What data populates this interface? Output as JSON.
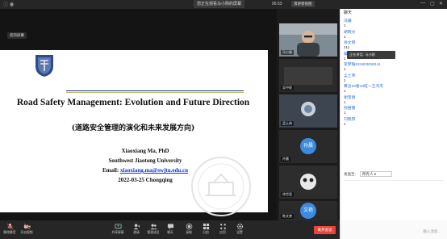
{
  "window": {
    "title": "您正在观看马小刚的屏幕"
  },
  "topbar": {
    "time": "06:53",
    "view_label": "演讲者视图"
  },
  "share": {
    "label": "您的屏幕",
    "slide": {
      "title_en": "Road Safety Management: Evolution and Future Direction",
      "title_cn": "(道路安全管理的演化和未来发展方向)",
      "author": "Xiaoxiang Ma, PhD",
      "university": "Southwest Jiaotong University",
      "email_label": "Email:",
      "email": "xiaoxiang.ma@swjtu.edu.cn",
      "date": "2022-03-25  Chongqing"
    }
  },
  "participants": [
    {
      "name": "马小刚",
      "type": "video",
      "avatar_text": ""
    },
    {
      "name": "吴中权",
      "type": "video",
      "avatar_text": ""
    },
    {
      "name": "孟土伟",
      "type": "video",
      "avatar_text": ""
    },
    {
      "name": "孙晨",
      "type": "avatar",
      "avatar_text": "孙晨"
    },
    {
      "name": "徐世君",
      "type": "video",
      "avatar_text": ""
    },
    {
      "name": "陈文艳",
      "type": "avatar",
      "avatar_text": "文艳"
    }
  ],
  "chat": {
    "title": "聊天",
    "speaking": "正在讲话: 马小刚",
    "messages": [
      {
        "name": "冯巍",
        "text": "1"
      },
      {
        "name": "胡晓文",
        "text": "1"
      },
      {
        "name": "徐文艳",
        "text": "111"
      },
      {
        "name": "蔡宏尧",
        "text": "1"
      },
      {
        "name": "李梦瑜631803090111",
        "text": "1"
      },
      {
        "name": "孟土伟",
        "text": "1"
      },
      {
        "name": "黄治20春19班一王鸿杰",
        "text": "1"
      },
      {
        "name": "谢宝丽",
        "text": "1"
      },
      {
        "name": "倪君健",
        "text": "1"
      },
      {
        "name": "刘晓燕",
        "text": "1"
      }
    ],
    "send_to_label": "发送至:",
    "send_to_value": "所有人",
    "input_placeholder": "输入消息..."
  },
  "toolbar": {
    "items": [
      {
        "label": "解除静音",
        "icon": "microphone-muted-icon"
      },
      {
        "label": "开启视频",
        "icon": "video-off-icon"
      },
      {
        "label": "共享屏幕",
        "icon": "share-screen-icon"
      },
      {
        "label": "邀请",
        "icon": "invite-icon"
      },
      {
        "label": "管理成员",
        "icon": "members-icon"
      },
      {
        "label": "聊天",
        "icon": "chat-icon"
      },
      {
        "label": "录制",
        "icon": "record-icon"
      },
      {
        "label": "分组",
        "icon": "breakout-icon"
      },
      {
        "label": "应用",
        "icon": "apps-icon"
      },
      {
        "label": "设置",
        "icon": "settings-icon"
      }
    ],
    "leave_label": "离开会议"
  }
}
